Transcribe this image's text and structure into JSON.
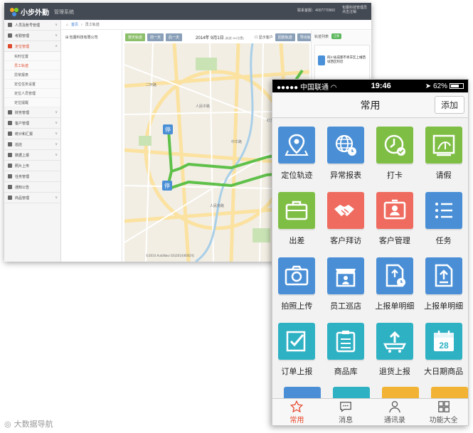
{
  "desktop": {
    "app_name": "小步外勤",
    "app_subtitle": "管理系统",
    "phone_label": "联系客服：4007770960",
    "user_label": "包蕾科技管理员",
    "user_sub": "点击注销",
    "sidebar": [
      {
        "label": "人员及账号管理",
        "active": false
      },
      {
        "label": "考勤管理",
        "active": false
      },
      {
        "label": "定位管理",
        "active": true
      }
    ],
    "sidebar_sub": [
      {
        "label": "实时位置",
        "active": false
      },
      {
        "label": "员工轨迹",
        "active": true
      },
      {
        "label": "异常报表",
        "active": false
      },
      {
        "label": "定位任务设置",
        "active": false
      },
      {
        "label": "定位人员管理",
        "active": false
      },
      {
        "label": "定位提醒",
        "active": false
      }
    ],
    "sidebar_more": [
      {
        "label": "财务管理"
      },
      {
        "label": "客户管理"
      },
      {
        "label": "统计和汇报"
      },
      {
        "label": "巡店"
      },
      {
        "label": "数据上报"
      },
      {
        "label": "照片上传"
      },
      {
        "label": "任务管理"
      },
      {
        "label": "通知公告"
      },
      {
        "label": "商品管理"
      }
    ],
    "breadcrumb_home": "首页",
    "breadcrumb_current": "员工轨迹",
    "tree_root": "包蕾科技有限公司",
    "toolbar_btn1": "按天轨迹",
    "toolbar_btn2": "前一天",
    "toolbar_btn3": "后一天",
    "date": "2014年 9月1日",
    "date_note": "(轨迹 161位置)",
    "show_customers": "显示客户",
    "toolbar_btn4": "回放轨迹",
    "toolbar_btn5": "导出轨迹",
    "list_title": "轨迹列表",
    "list_badge": "正常",
    "list_addr": "四川省成都市青羊区上幢西城西区附近",
    "map_marker": "停",
    "map_copyright": "©2014 AutoNavi GS(2014)6002号",
    "map_roads": [
      "人民中路",
      "中华路",
      "人民南路",
      "二环路",
      "红星路"
    ]
  },
  "phone": {
    "carrier": "●●●●● 中国联通",
    "time": "19:46",
    "battery": "62%",
    "title": "常用",
    "add_button": "添加",
    "tiles": [
      {
        "label": "定位轨迹",
        "color": "#4a8fd6",
        "icon": "map-pin-icon"
      },
      {
        "label": "异常报表",
        "color": "#4a8fd6",
        "icon": "globe-clock-icon"
      },
      {
        "label": "打卡",
        "color": "#7fbe45",
        "icon": "clock-check-icon"
      },
      {
        "label": "请假",
        "color": "#7fbe45",
        "icon": "vacation-icon"
      },
      {
        "label": "出差",
        "color": "#7fbe45",
        "icon": "briefcase-icon"
      },
      {
        "label": "客户拜访",
        "color": "#ef6b5f",
        "icon": "handshake-icon"
      },
      {
        "label": "客户管理",
        "color": "#ef6b5f",
        "icon": "contact-card-icon"
      },
      {
        "label": "任务",
        "color": "#4a8fd6",
        "icon": "task-list-icon"
      },
      {
        "label": "拍照上传",
        "color": "#4a8fd6",
        "icon": "camera-icon"
      },
      {
        "label": "员工巡店",
        "color": "#4a8fd6",
        "icon": "store-icon"
      },
      {
        "label": "上报单明细",
        "color": "#4a8fd6",
        "icon": "report-clock-icon"
      },
      {
        "label": "上报单明细",
        "color": "#4a8fd6",
        "icon": "report-upload-icon"
      },
      {
        "label": "订单上报",
        "color": "#2fb1c4",
        "icon": "order-check-icon"
      },
      {
        "label": "商品库",
        "color": "#2fb1c4",
        "icon": "clipboard-list-icon"
      },
      {
        "label": "退货上报",
        "color": "#2fb1c4",
        "icon": "cart-upload-icon"
      },
      {
        "label": "大日期商品",
        "color": "#2fb1c4",
        "icon": "calendar-icon"
      }
    ],
    "calendar_number": "28",
    "partial_colors": [
      "#4a8fd6",
      "#2fb1c4",
      "#f2b233",
      "#f2b233"
    ],
    "tabs": [
      {
        "label": "常用",
        "active": true,
        "icon": "star-icon"
      },
      {
        "label": "消息",
        "active": false,
        "icon": "message-icon"
      },
      {
        "label": "通讯录",
        "active": false,
        "icon": "contacts-icon"
      },
      {
        "label": "功能大全",
        "active": false,
        "icon": "grid-icon"
      }
    ]
  },
  "watermark": "大数据导航"
}
